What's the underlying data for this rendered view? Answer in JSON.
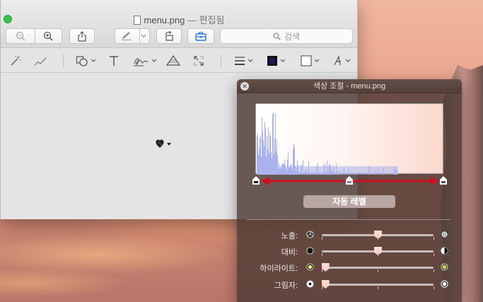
{
  "window": {
    "title": "menu.png",
    "subtitle": "— 편집됨"
  },
  "toolbar": {
    "search_placeholder": "검색"
  },
  "hud": {
    "title": "색상 조절 - menu.png",
    "auto_levels_label": "자동 레벨",
    "sliders": [
      {
        "label": "노출:",
        "value": 0.5
      },
      {
        "label": "대비:",
        "value": 0.5
      },
      {
        "label": "하이라이트:",
        "value": 0.03
      },
      {
        "label": "그림자:",
        "value": 0.03
      }
    ]
  },
  "colors": {
    "close_button": "#39c24a",
    "stroke_color": "#1a1a5e",
    "histogram_bars": "#a9b2ec",
    "level_arrow": "#d01020"
  },
  "icons": {
    "window": "document-icon",
    "zoom_out": "zoom-out-icon",
    "zoom_in": "zoom-in-icon",
    "share": "share-icon",
    "markup": "pen-icon",
    "rotate": "rotate-icon",
    "toolbox": "toolbox-icon",
    "search": "search-icon"
  }
}
